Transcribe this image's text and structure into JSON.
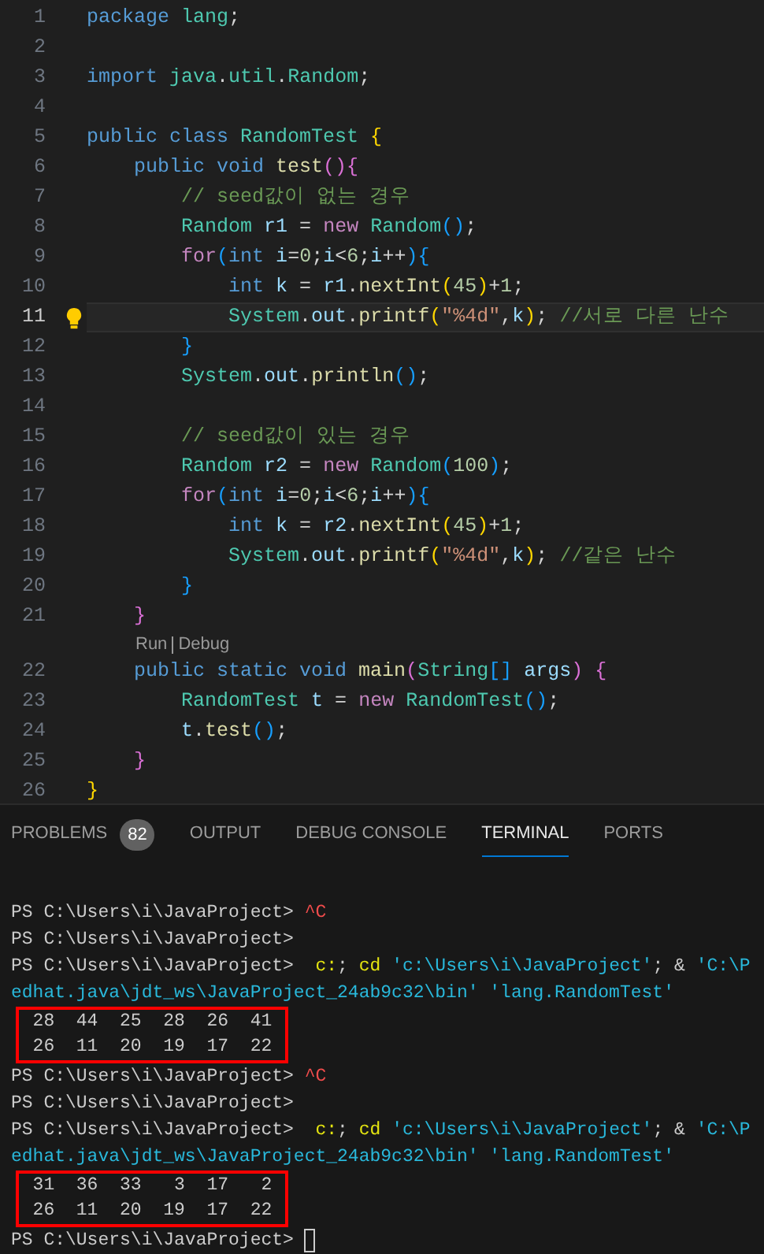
{
  "editor": {
    "lines": [
      {
        "kind": "code",
        "number": "1",
        "selected": false,
        "tokens": [
          {
            "kind": "kw",
            "text": "package"
          },
          {
            "kind": "type",
            "text": " lang"
          },
          {
            "kind": "p",
            "text": ";"
          }
        ]
      },
      {
        "kind": "code",
        "number": "2",
        "selected": false
      },
      {
        "kind": "code",
        "number": "3",
        "selected": false,
        "tokens": [
          {
            "kind": "kw",
            "text": "import"
          },
          {
            "kind": "type",
            "text": " java"
          },
          {
            "kind": "p",
            "text": "."
          },
          {
            "kind": "type",
            "text": "util"
          },
          {
            "kind": "p",
            "text": "."
          },
          {
            "kind": "type",
            "text": "Random"
          },
          {
            "kind": "p",
            "text": ";"
          }
        ]
      },
      {
        "kind": "code",
        "number": "4",
        "selected": false
      },
      {
        "kind": "code",
        "number": "5",
        "selected": false,
        "tokens": [
          {
            "kind": "kw",
            "text": "public class"
          },
          {
            "kind": "type",
            "text": " RandomTest"
          },
          {
            "kind": "b1",
            "text": " {"
          }
        ]
      },
      {
        "kind": "code",
        "number": "6",
        "selected": false,
        "tokens": [
          {
            "kind": "kw",
            "text": "    public void"
          },
          {
            "kind": "fn",
            "text": " test"
          },
          {
            "kind": "b2",
            "text": "(){"
          }
        ]
      },
      {
        "kind": "code",
        "number": "7",
        "selected": false,
        "tokens": [
          {
            "kind": "com",
            "text": "        // seed값이 없는 경우"
          }
        ]
      },
      {
        "kind": "code",
        "number": "8",
        "selected": false,
        "tokens": [
          {
            "kind": "type",
            "text": "        Random"
          },
          {
            "kind": "var",
            "text": " r1"
          },
          {
            "kind": "p",
            "text": " = "
          },
          {
            "kind": "ctl",
            "text": "new"
          },
          {
            "kind": "type",
            "text": " Random"
          },
          {
            "kind": "b3",
            "text": "()"
          },
          {
            "kind": "p",
            "text": ";"
          }
        ]
      },
      {
        "kind": "code",
        "number": "9",
        "selected": false,
        "tokens": [
          {
            "kind": "ctl",
            "text": "        for"
          },
          {
            "kind": "b3",
            "text": "("
          },
          {
            "kind": "kw",
            "text": "int"
          },
          {
            "kind": "var",
            "text": " i"
          },
          {
            "kind": "p",
            "text": "="
          },
          {
            "kind": "num",
            "text": "0"
          },
          {
            "kind": "p",
            "text": ";"
          },
          {
            "kind": "var",
            "text": "i"
          },
          {
            "kind": "p",
            "text": "<"
          },
          {
            "kind": "num",
            "text": "6"
          },
          {
            "kind": "p",
            "text": ";"
          },
          {
            "kind": "var",
            "text": "i"
          },
          {
            "kind": "p",
            "text": "++"
          },
          {
            "kind": "b3",
            "text": "){"
          }
        ]
      },
      {
        "kind": "code",
        "number": "10",
        "selected": false,
        "tokens": [
          {
            "kind": "kw",
            "text": "            int"
          },
          {
            "kind": "var",
            "text": " k"
          },
          {
            "kind": "p",
            "text": " = "
          },
          {
            "kind": "var",
            "text": "r1"
          },
          {
            "kind": "p",
            "text": "."
          },
          {
            "kind": "fn",
            "text": "nextInt"
          },
          {
            "kind": "b1",
            "text": "("
          },
          {
            "kind": "num",
            "text": "45"
          },
          {
            "kind": "b1",
            "text": ")"
          },
          {
            "kind": "p",
            "text": "+"
          },
          {
            "kind": "num",
            "text": "1"
          },
          {
            "kind": "p",
            "text": ";"
          }
        ]
      },
      {
        "kind": "code",
        "number": "11",
        "selected": true,
        "tokens": [
          {
            "kind": "type",
            "text": "            System"
          },
          {
            "kind": "p",
            "text": "."
          },
          {
            "kind": "var",
            "text": "out"
          },
          {
            "kind": "p",
            "text": "."
          },
          {
            "kind": "fn",
            "text": "printf"
          },
          {
            "kind": "b1",
            "text": "("
          },
          {
            "kind": "str",
            "text": "\"%4d\""
          },
          {
            "kind": "p",
            "text": ","
          },
          {
            "kind": "var",
            "text": "k"
          },
          {
            "kind": "b1",
            "text": ")"
          },
          {
            "kind": "p",
            "text": ";"
          },
          {
            "kind": "com",
            "text": " //서로 다른 난수"
          }
        ]
      },
      {
        "kind": "code",
        "number": "12",
        "selected": false,
        "tokens": [
          {
            "kind": "b3",
            "text": "        }"
          }
        ]
      },
      {
        "kind": "code",
        "number": "13",
        "selected": false,
        "tokens": [
          {
            "kind": "type",
            "text": "        System"
          },
          {
            "kind": "p",
            "text": "."
          },
          {
            "kind": "var",
            "text": "out"
          },
          {
            "kind": "p",
            "text": "."
          },
          {
            "kind": "fn",
            "text": "println"
          },
          {
            "kind": "b3",
            "text": "()"
          },
          {
            "kind": "p",
            "text": ";"
          }
        ]
      },
      {
        "kind": "code",
        "number": "14",
        "selected": false
      },
      {
        "kind": "code",
        "number": "15",
        "selected": false,
        "tokens": [
          {
            "kind": "com",
            "text": "        // seed값이 있는 경우"
          }
        ]
      },
      {
        "kind": "code",
        "number": "16",
        "selected": false,
        "tokens": [
          {
            "kind": "type",
            "text": "        Random"
          },
          {
            "kind": "var",
            "text": " r2"
          },
          {
            "kind": "p",
            "text": " = "
          },
          {
            "kind": "ctl",
            "text": "new"
          },
          {
            "kind": "type",
            "text": " Random"
          },
          {
            "kind": "b3",
            "text": "("
          },
          {
            "kind": "num",
            "text": "100"
          },
          {
            "kind": "b3",
            "text": ")"
          },
          {
            "kind": "p",
            "text": ";"
          }
        ]
      },
      {
        "kind": "code",
        "number": "17",
        "selected": false,
        "tokens": [
          {
            "kind": "ctl",
            "text": "        for"
          },
          {
            "kind": "b3",
            "text": "("
          },
          {
            "kind": "kw",
            "text": "int"
          },
          {
            "kind": "var",
            "text": " i"
          },
          {
            "kind": "p",
            "text": "="
          },
          {
            "kind": "num",
            "text": "0"
          },
          {
            "kind": "p",
            "text": ";"
          },
          {
            "kind": "var",
            "text": "i"
          },
          {
            "kind": "p",
            "text": "<"
          },
          {
            "kind": "num",
            "text": "6"
          },
          {
            "kind": "p",
            "text": ";"
          },
          {
            "kind": "var",
            "text": "i"
          },
          {
            "kind": "p",
            "text": "++"
          },
          {
            "kind": "b3",
            "text": "){"
          }
        ]
      },
      {
        "kind": "code",
        "number": "18",
        "selected": false,
        "tokens": [
          {
            "kind": "kw",
            "text": "            int"
          },
          {
            "kind": "var",
            "text": " k"
          },
          {
            "kind": "p",
            "text": " = "
          },
          {
            "kind": "var",
            "text": "r2"
          },
          {
            "kind": "p",
            "text": "."
          },
          {
            "kind": "fn",
            "text": "nextInt"
          },
          {
            "kind": "b1",
            "text": "("
          },
          {
            "kind": "num",
            "text": "45"
          },
          {
            "kind": "b1",
            "text": ")"
          },
          {
            "kind": "p",
            "text": "+"
          },
          {
            "kind": "num",
            "text": "1"
          },
          {
            "kind": "p",
            "text": ";"
          }
        ]
      },
      {
        "kind": "code",
        "number": "19",
        "selected": false,
        "tokens": [
          {
            "kind": "type",
            "text": "            System"
          },
          {
            "kind": "p",
            "text": "."
          },
          {
            "kind": "var",
            "text": "out"
          },
          {
            "kind": "p",
            "text": "."
          },
          {
            "kind": "fn",
            "text": "printf"
          },
          {
            "kind": "b1",
            "text": "("
          },
          {
            "kind": "str",
            "text": "\"%4d\""
          },
          {
            "kind": "p",
            "text": ","
          },
          {
            "kind": "var",
            "text": "k"
          },
          {
            "kind": "b1",
            "text": ")"
          },
          {
            "kind": "p",
            "text": ";"
          },
          {
            "kind": "com",
            "text": " //같은 난수"
          }
        ]
      },
      {
        "kind": "code",
        "number": "20",
        "selected": false,
        "tokens": [
          {
            "kind": "b3",
            "text": "        }"
          }
        ]
      },
      {
        "kind": "code",
        "number": "21",
        "selected": false,
        "tokens": [
          {
            "kind": "b2",
            "text": "    }"
          }
        ]
      },
      {
        "kind": "codelens",
        "links": [
          "Run",
          "Debug"
        ]
      },
      {
        "kind": "code",
        "number": "22",
        "selected": false,
        "tokens": [
          {
            "kind": "kw",
            "text": "    public static void"
          },
          {
            "kind": "fn",
            "text": " main"
          },
          {
            "kind": "b2",
            "text": "("
          },
          {
            "kind": "type",
            "text": "String"
          },
          {
            "kind": "b3",
            "text": "[]"
          },
          {
            "kind": "var",
            "text": " args"
          },
          {
            "kind": "b2",
            "text": ") {"
          }
        ]
      },
      {
        "kind": "code",
        "number": "23",
        "selected": false,
        "tokens": [
          {
            "kind": "type",
            "text": "        RandomTest"
          },
          {
            "kind": "var",
            "text": " t"
          },
          {
            "kind": "p",
            "text": " = "
          },
          {
            "kind": "ctl",
            "text": "new"
          },
          {
            "kind": "type",
            "text": " RandomTest"
          },
          {
            "kind": "b3",
            "text": "()"
          },
          {
            "kind": "p",
            "text": ";"
          }
        ]
      },
      {
        "kind": "code",
        "number": "24",
        "selected": false,
        "tokens": [
          {
            "kind": "var",
            "text": "        t"
          },
          {
            "kind": "p",
            "text": "."
          },
          {
            "kind": "fn",
            "text": "test"
          },
          {
            "kind": "b3",
            "text": "()"
          },
          {
            "kind": "p",
            "text": ";"
          }
        ]
      },
      {
        "kind": "code",
        "number": "25",
        "selected": false,
        "tokens": [
          {
            "kind": "b2",
            "text": "    }"
          }
        ]
      },
      {
        "kind": "code",
        "number": "26",
        "selected": false,
        "tokens": [
          {
            "kind": "b1",
            "text": "}"
          }
        ]
      }
    ]
  },
  "panel": {
    "tabs": [
      {
        "label": "PROBLEMS",
        "badge": "82",
        "selected": false
      },
      {
        "label": "OUTPUT",
        "selected": false
      },
      {
        "label": "DEBUG CONSOLE",
        "selected": false
      },
      {
        "label": "TERMINAL",
        "selected": true
      },
      {
        "label": "PORTS",
        "selected": false
      }
    ],
    "terminal": {
      "cursor": true,
      "entries": [
        {
          "kind": "line",
          "tokens": [
            {
              "kind": "p",
              "text": "PS C:\\Users\\i\\JavaProject>"
            },
            {
              "kind": "err",
              "text": " ^C"
            }
          ]
        },
        {
          "kind": "line",
          "tokens": [
            {
              "kind": "p",
              "text": "PS C:\\Users\\i\\JavaProject>"
            }
          ]
        },
        {
          "kind": "line",
          "tokens": [
            {
              "kind": "p",
              "text": "PS C:\\Users\\i\\JavaProject>"
            },
            {
              "kind": "cmd",
              "text": "  c:"
            },
            {
              "kind": "p",
              "text": "; "
            },
            {
              "kind": "cmd",
              "text": "cd"
            },
            {
              "kind": "str",
              "text": " 'c:\\Users\\i\\JavaProject'"
            },
            {
              "kind": "p",
              "text": "; & "
            },
            {
              "kind": "str",
              "text": "'C:\\P"
            }
          ]
        },
        {
          "kind": "line",
          "tokens": [
            {
              "kind": "str",
              "text": "edhat.java\\jdt_ws\\JavaProject_24ab9c32\\bin' 'lang.RandomTest'"
            }
          ]
        },
        {
          "kind": "output",
          "rows": [
            "  28  44  25  28  26  41",
            "  26  11  20  19  17  22"
          ]
        },
        {
          "kind": "line",
          "tokens": [
            {
              "kind": "p",
              "text": "PS C:\\Users\\i\\JavaProject>"
            },
            {
              "kind": "err",
              "text": " ^C"
            }
          ]
        },
        {
          "kind": "line",
          "tokens": [
            {
              "kind": "p",
              "text": "PS C:\\Users\\i\\JavaProject>"
            }
          ]
        },
        {
          "kind": "line",
          "tokens": [
            {
              "kind": "p",
              "text": "PS C:\\Users\\i\\JavaProject>"
            },
            {
              "kind": "cmd",
              "text": "  c:"
            },
            {
              "kind": "p",
              "text": "; "
            },
            {
              "kind": "cmd",
              "text": "cd"
            },
            {
              "kind": "str",
              "text": " 'c:\\Users\\i\\JavaProject'"
            },
            {
              "kind": "p",
              "text": "; & "
            },
            {
              "kind": "str",
              "text": "'C:\\P"
            }
          ]
        },
        {
          "kind": "line",
          "tokens": [
            {
              "kind": "str",
              "text": "edhat.java\\jdt_ws\\JavaProject_24ab9c32\\bin' 'lang.RandomTest'"
            }
          ]
        },
        {
          "kind": "output",
          "rows": [
            "  31  36  33   3  17   2",
            "  26  11  20  19  17  22"
          ]
        },
        {
          "kind": "line",
          "tokens": [
            {
              "kind": "p",
              "text": "PS C:\\Users\\i\\JavaProject> "
            }
          ]
        }
      ]
    }
  }
}
